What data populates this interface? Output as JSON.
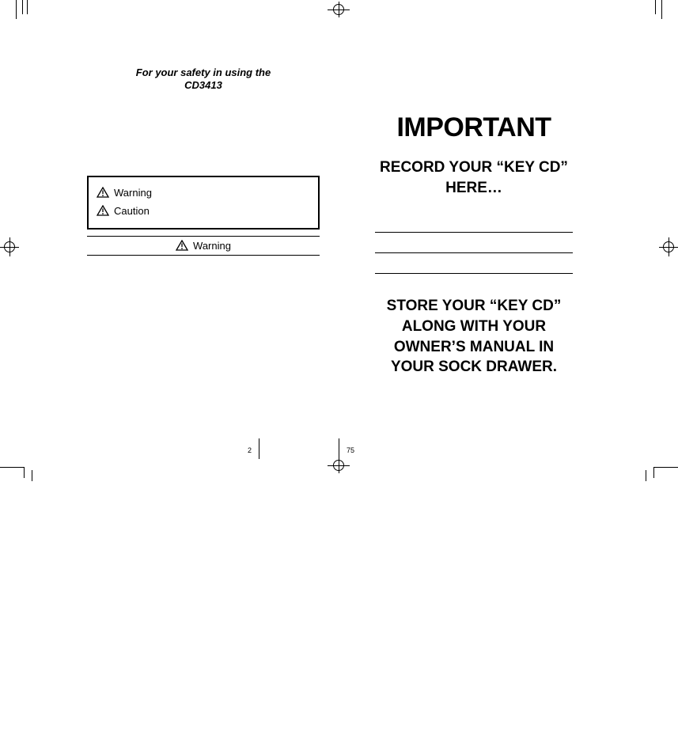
{
  "left_page": {
    "safety_heading_line1": "For your safety in using the",
    "safety_heading_line2": "CD3413",
    "box": {
      "row1_label": "Warning",
      "row2_label": "Caution"
    },
    "center_warning_label": "Warning",
    "page_number": "2"
  },
  "right_page": {
    "important": "IMPORTANT",
    "record_line1": "RECORD YOUR “KEY CD”",
    "record_line2": "HERE…",
    "store_line1": "STORE YOUR “KEY CD”",
    "store_line2": "ALONG WITH YOUR",
    "store_line3": "OWNER’S MANUAL IN",
    "store_line4": "YOUR SOCK DRAWER.",
    "page_number": "75"
  }
}
